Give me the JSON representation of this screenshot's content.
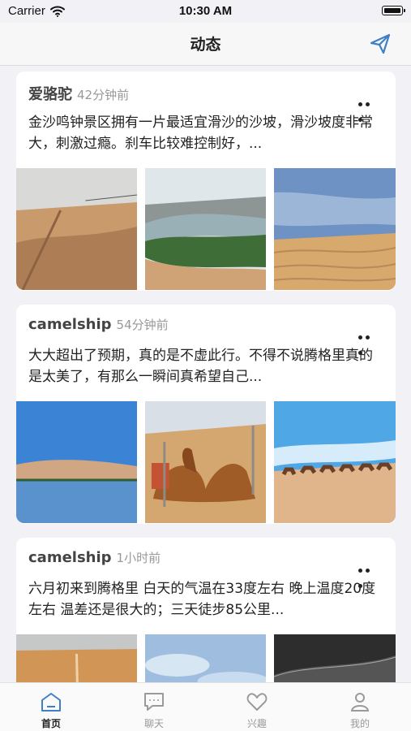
{
  "status_bar": {
    "carrier": "Carrier",
    "time": "10:30 AM"
  },
  "nav": {
    "title": "动态",
    "action_icon": "send-icon"
  },
  "posts": [
    {
      "author": "爱骆驼",
      "time": "42分钟前",
      "text": "金沙鸣钟景区拥有一片最适宜滑沙的沙坡，滑沙坡度非常大，刺激过瘾。刹车比较难控制好，...",
      "photos": [
        "desert-slope-with-cable-line",
        "river-oasis-in-desert",
        "sand-dune-with-blue-sky"
      ]
    },
    {
      "author": "camelship",
      "time": "54分钟前",
      "text": "大大超出了预期，真的是不虚此行。不得不说腾格里真的是太美了，有那么一瞬间真希望自己...",
      "photos": [
        "desert-lake",
        "resting-camels",
        "camel-caravan"
      ]
    },
    {
      "author": "camelship",
      "time": "1小时前",
      "text": "六月初来到腾格里 白天的气温在33度左右 晚上温度20度左右 温差还是很大的；三天徒步85公里...",
      "photos": [
        "desert-track",
        "cloudy-sky",
        "dark-dune"
      ]
    }
  ],
  "tabs": [
    {
      "label": "首页",
      "icon": "home-icon",
      "active": true
    },
    {
      "label": "聊天",
      "icon": "chat-icon",
      "active": false
    },
    {
      "label": "兴趣",
      "icon": "heart-icon",
      "active": false
    },
    {
      "label": "我的",
      "icon": "profile-icon",
      "active": false
    }
  ],
  "colors": {
    "accent": "#3f7fc7",
    "background": "#f2f2f6",
    "card": "#ffffff"
  }
}
